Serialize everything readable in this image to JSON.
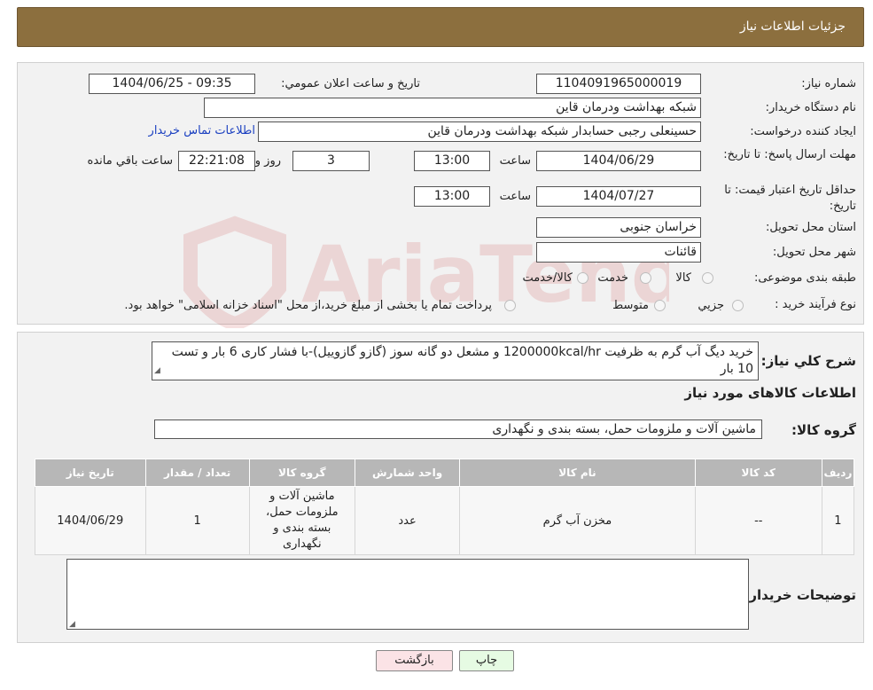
{
  "header": {
    "title": "جزئیات اطلاعات نیاز"
  },
  "form": {
    "need_number_label": "شماره نیاز:",
    "need_number": "1104091965000019",
    "announce_label": "تاریخ و ساعت اعلان عمومي:",
    "announce_value": "1404/06/25 - 09:35",
    "buyer_org_label": "نام دستگاه خريدار:",
    "buyer_org": "شبکه بهداشت ودرمان قاین",
    "creator_label": "ايجاد کننده درخواست:",
    "creator": "حسینعلی رجبی حسابدار شبکه بهداشت ودرمان قاین",
    "contact_link": "اطلاعات تماس خريدار",
    "deadline_label": "مهلت ارسال پاسخ: تا تاريخ:",
    "deadline_date": "1404/06/29",
    "time_label": "ساعت",
    "deadline_time": "13:00",
    "days": "3",
    "days_label": "روز و",
    "remaining_time": "22:21:08",
    "remaining_label": "ساعت باقي مانده",
    "validity_label": "حداقل تاريخ اعتبار قيمت: تا تاريخ:",
    "validity_date": "1404/07/27",
    "validity_time": "13:00",
    "province_label": "استان محل تحويل:",
    "province": "خراسان جنوبی",
    "city_label": "شهر محل تحويل:",
    "city": "قائنات",
    "category_label": "طبقه بندی موضوعی:",
    "category_options": [
      "کالا",
      "خدمت",
      "کالا/خدمت"
    ],
    "process_label": "نوع فرآيند خريد :",
    "process_options": [
      "جزيي",
      "متوسط"
    ],
    "process_note": "پرداخت تمام يا بخشی از مبلغ خريد،از محل \"اسناد خزانه اسلامی\" خواهد بود."
  },
  "summary": {
    "label": "شرح کلي نياز:",
    "text": "خرید دیگ آب گرم به ظرفیت 1200000kcal/hr و مشعل دو گانه سوز (گازو گازوییل)-با فشار کاری 6 بار و تست 10 بار",
    "items_title": "اطلاعات کالاهای مورد نياز",
    "group_label": "گروه کالا:",
    "group_value": "ماشین آلات و ملزومات حمل، بسته بندی و نگهداری"
  },
  "table": {
    "headers": [
      "رديف",
      "کد کالا",
      "نام کالا",
      "واحد شمارش",
      "گروه کالا",
      "تعداد / مقدار",
      "تاريخ نياز"
    ],
    "rows": [
      [
        "1",
        "--",
        "مخزن آب گرم",
        "عدد",
        "ماشین آلات و ملزومات حمل، بسته بندی و نگهداری",
        "1",
        "1404/06/29"
      ]
    ]
  },
  "buyer_notes": {
    "label": "توضيحات خريدار:",
    "value": ""
  },
  "buttons": {
    "print": "چاپ",
    "back": "بازگشت"
  },
  "colors": {
    "header": "#8c6f3e",
    "table_header": "#b7b7b7",
    "back_button": "#fbe3e6",
    "print_button": "#e6fbe3"
  }
}
